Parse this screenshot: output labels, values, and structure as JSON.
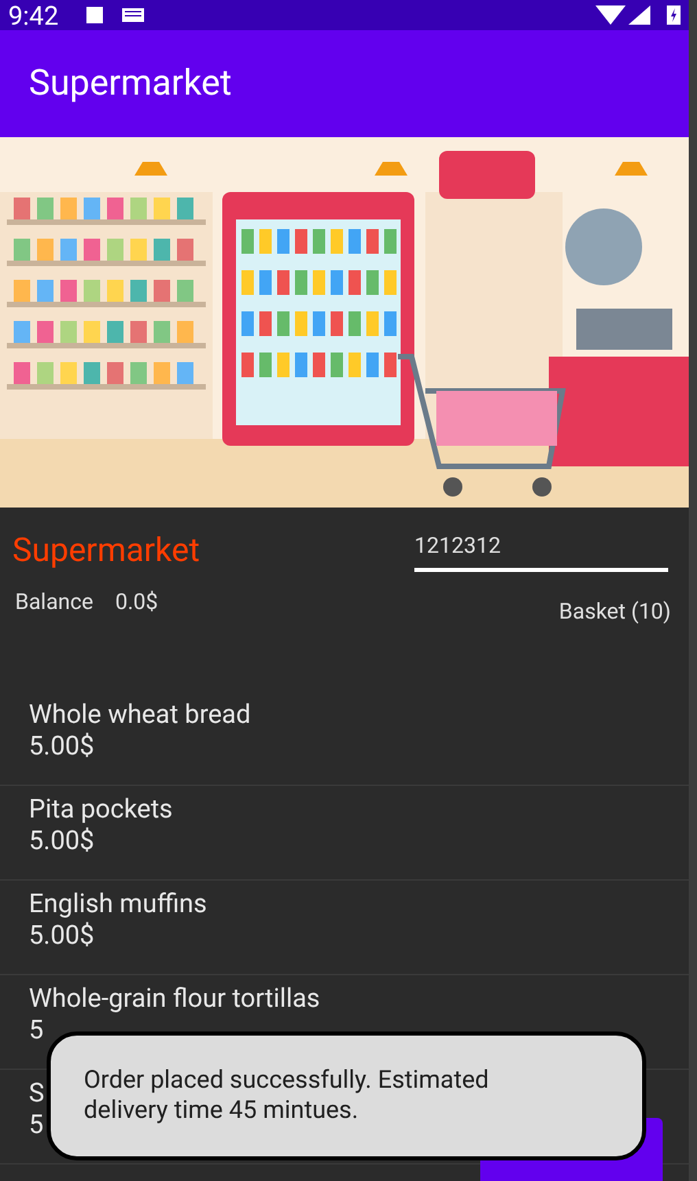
{
  "status_bar": {
    "time": "9:42"
  },
  "app_bar": {
    "title": "Supermarket"
  },
  "store": {
    "name": "Supermarket",
    "code_field": {
      "value": "1212312"
    },
    "balance_label": "Balance",
    "balance_value": "0.0$",
    "basket": "Basket (10)"
  },
  "products": [
    {
      "name": "Whole wheat bread",
      "price": "5.00$"
    },
    {
      "name": "Pita pockets",
      "price": "5.00$"
    },
    {
      "name": "English muffins",
      "price": "5.00$"
    },
    {
      "name": "Whole-grain flour tortillas",
      "price": "5"
    },
    {
      "name": "S",
      "price": "5"
    }
  ],
  "toast": "Order placed successfully. Estimated delivery time 45 mintues."
}
